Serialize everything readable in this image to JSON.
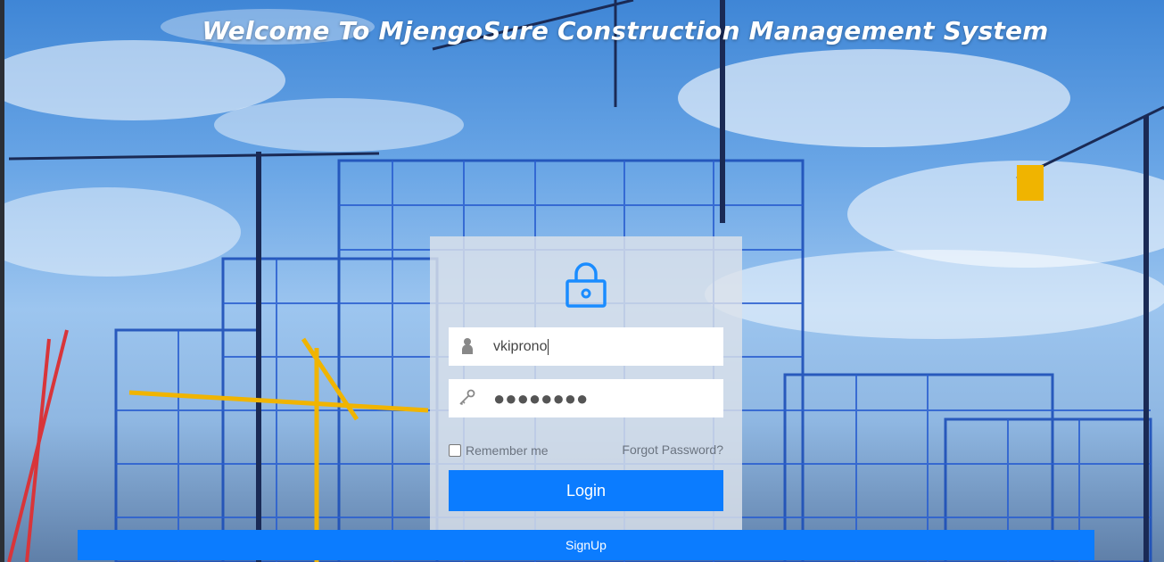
{
  "header": {
    "welcome_text": "Welcome To MjengoSure Construction Management System"
  },
  "login_form": {
    "username_value": "vkiprono",
    "password_mask": "●●●●●●●●",
    "remember_label": "Remember me",
    "remember_checked": false,
    "forgot_label": "Forgot Password?",
    "login_label": "Login"
  },
  "footer": {
    "signup_label": "SignUp"
  },
  "icons": {
    "lock": "lock-icon",
    "user": "user-icon",
    "key": "key-icon"
  },
  "colors": {
    "accent": "#0b7cff",
    "panel": "#dce2ea",
    "lock_icon": "#1a8cff"
  }
}
